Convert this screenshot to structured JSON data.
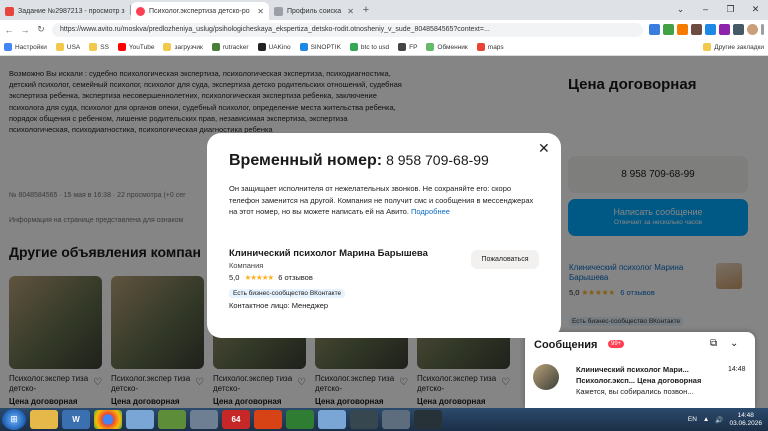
{
  "tabs": [
    {
      "title": "Задание №2987213 - просмотр з",
      "color": "#e8453c",
      "active": false
    },
    {
      "title": "Психолог.экспертиза детско-ро",
      "color": "#ff4053",
      "active": true
    },
    {
      "title": "Профиль соиска",
      "color": "#9aa0a6",
      "active": false
    }
  ],
  "browser": {
    "url": "https://www.avito.ru/moskva/predlozheniya_uslug/psihologicheskaya_ekspertiza_detsko-rodit.otnosheniy_v_sude_8048584565?context=..."
  },
  "bookmarks": [
    "Настройки",
    "USA",
    "SS",
    "YouTube",
    "загрузчик",
    "rutracker",
    "UAKino",
    "SINOPTIK",
    "btc to usd",
    "FP",
    "Обменник",
    "maps"
  ],
  "bookmarks_other": "Другие закладки",
  "page": {
    "description": "Возможно Вы искали : судебно психологическая экспертиза, психологическая экспертиза, психодиагностика, детский психолог, семейный психолог, психолог для суда, экспертиза детско родительских отношений, судебная экспертиза ребенка, экспертиза несовершеннолетних, психологическая экспертиза ребенка, заключение психолога для суда, психолог для органов опеки, судебный психолог, определение места жительства ребенка, порядок общения с ребенком, лишение родительских прав, независимая экспертиза, экспертиза психологическая, психодиагностика, психологическая диагностика ребенка",
    "meta": "№ 8048584565 · 15 мая в 16:38 · 22 просмотра (+0 сег",
    "info": "Информация на странице представлена для ознаком",
    "other_heading": "Другие объявления компан",
    "cards": [
      {
        "title": "Психолог.экспер тиза детско-",
        "price": "Цена договорная"
      },
      {
        "title": "Психолог.экспер тиза детско-",
        "price": "Цена договорная"
      },
      {
        "title": "Психолог.экспер тиза детско-",
        "price": "Цена договорная"
      },
      {
        "title": "Психолог.экспер тиза детско-",
        "price": "Цена договорная"
      },
      {
        "title": "Психолог.экспер тиза детско-",
        "price": "Цена договорная"
      }
    ],
    "price_heading": "Цена договорная",
    "phone_button": "8 958 709-68-99",
    "message_button": "Написать сообщение",
    "message_sub": "Отвечает за несколько часов",
    "seller_name": "Клинический психолог Марина Барышева",
    "seller_rating": "5,0",
    "seller_stars": "★★★★★",
    "seller_reviews": "6 отзывов",
    "seller_badge": "Есть бизнес-сообщество ВКонтакте"
  },
  "modal": {
    "title": "Временный номер:",
    "phone": "8 958 709-68-99",
    "text": "Он защищает исполнителя от нежелательных звонков. Не сохраняйте его: скоро телефон заменится на другой. Компания не получит смс и сообщения в мессенджерах на этот номер, но вы можете написать ей на Авито.",
    "more": "Подробнее",
    "name": "Клинический психолог Марина Барышева",
    "type": "Компания",
    "rating": "5,0",
    "stars": "★★★★★",
    "reviews": "6 отзывов",
    "badge": "Есть бизнес-сообщество ВКонтакте",
    "contact": "Контактное лицо: Менеджер",
    "complain": "Пожаловаться"
  },
  "chat": {
    "title": "Сообщения",
    "badge": "99+",
    "sender": "Клинический психолог Мари...",
    "subject": "Психолог.эксп... Цена договорная",
    "preview": "Кажется, вы собирались позвон...",
    "time": "14:48"
  },
  "taskbar": {
    "lang": "EN",
    "time": "14:48",
    "date": "03.06.2026"
  }
}
